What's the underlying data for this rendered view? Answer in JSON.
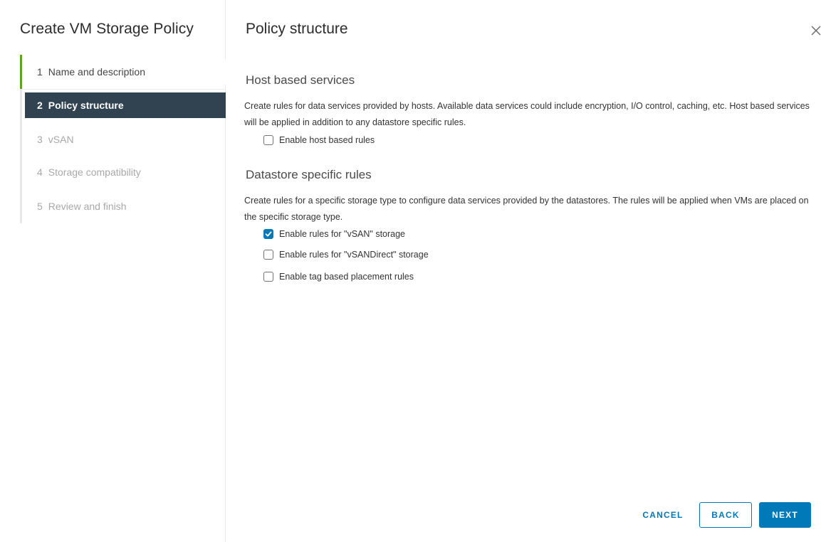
{
  "wizard": {
    "title": "Create VM Storage Policy",
    "steps": [
      {
        "number": "1",
        "label": "Name and description",
        "state": "completed"
      },
      {
        "number": "2",
        "label": "Policy structure",
        "state": "active"
      },
      {
        "number": "3",
        "label": "vSAN",
        "state": "disabled"
      },
      {
        "number": "4",
        "label": "Storage compatibility",
        "state": "disabled"
      },
      {
        "number": "5",
        "label": "Review and finish",
        "state": "disabled"
      }
    ]
  },
  "page": {
    "title": "Policy structure",
    "host_section": {
      "title": "Host based services",
      "description": "Create rules for data services provided by hosts. Available data services could include encryption, I/O control, caching, etc. Host based services will be applied in addition to any datastore specific rules.",
      "checkbox": {
        "label": "Enable host based rules",
        "checked": false
      }
    },
    "datastore_section": {
      "title": "Datastore specific rules",
      "description": "Create rules for a specific storage type to configure data services provided by the datastores. The rules will be applied when VMs are placed on the specific storage type.",
      "checkboxes": [
        {
          "label": "Enable rules for \"vSAN\" storage",
          "checked": true
        },
        {
          "label": "Enable rules for \"vSANDirect\" storage",
          "checked": false
        },
        {
          "label": "Enable tag based placement rules",
          "checked": false
        }
      ]
    }
  },
  "footer": {
    "cancel_label": "CANCEL",
    "back_label": "BACK",
    "next_label": "NEXT"
  },
  "colors": {
    "accent": "#0079b8",
    "active_step_bg": "#314351",
    "completed_step_bar": "#62a420"
  },
  "icons": {
    "close": "close-icon",
    "check": "checkmark-icon"
  }
}
